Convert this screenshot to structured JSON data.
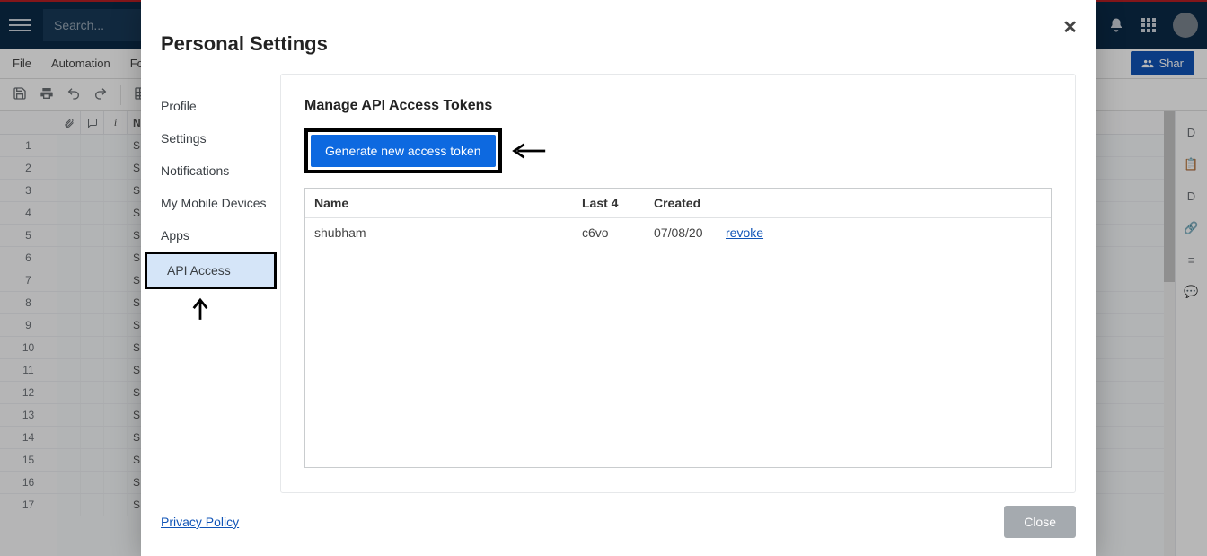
{
  "navbar": {
    "search_placeholder": "Search..."
  },
  "menubar": {
    "file": "File",
    "automation": "Automation",
    "forms": "For",
    "share": "Shar"
  },
  "sheet": {
    "columns": {
      "name_header": "Nam",
      "first_body_prefix": "S"
    },
    "row_count": 17
  },
  "modal": {
    "title": "Personal Settings",
    "nav": {
      "profile": "Profile",
      "settings": "Settings",
      "notifications": "Notifications",
      "mobile": "My Mobile Devices",
      "apps": "Apps",
      "api": "API Access"
    },
    "content": {
      "heading": "Manage API Access Tokens",
      "generate_label": "Generate new access token",
      "table": {
        "headers": {
          "name": "Name",
          "last4": "Last 4",
          "created": "Created"
        },
        "rows": [
          {
            "name": "shubham",
            "last4": "c6vo",
            "created": "07/08/20",
            "action": "revoke"
          }
        ]
      }
    },
    "footer": {
      "privacy": "Privacy Policy",
      "close": "Close"
    }
  },
  "right_rail": {
    "label_top": "D",
    "label_mid": "D"
  }
}
